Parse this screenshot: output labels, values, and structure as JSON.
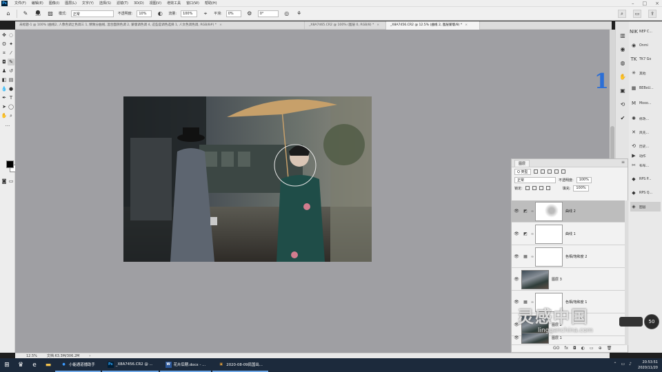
{
  "menu": {
    "items": [
      "文件(F)",
      "编辑(E)",
      "图像(I)",
      "图层(L)",
      "文字(Y)",
      "选择(S)",
      "滤镜(T)",
      "3D(D)",
      "视图(V)",
      "增效工具",
      "窗口(W)",
      "帮助(H)"
    ],
    "app_icon": "Ps"
  },
  "options": {
    "brush_size": "100",
    "mode_label": "模式:",
    "mode_value": "正常",
    "opacity_label": "不透明度:",
    "opacity_value": "10%",
    "flow_label": "流量:",
    "flow_value": "100%",
    "smooth_label": "平滑:",
    "smooth_value": "0%",
    "angle_value": "0°"
  },
  "tabs": [
    {
      "label": "未标题-1 @ 100% (曲线2, 人像色调之色调三 1, 精致分曲线, 混合面阴色调 2, 蒙版调色调 4, 这些是调色选择 1, 人文色调色调, RGB/8#) *",
      "close": "×"
    },
    {
      "label": "_X8A7465.CR2 @ 100% (图层 0, RGB/8) *",
      "close": "×"
    },
    {
      "label": "_X8A7456.CR2 @ 12.5% (曲线 2, 图层蒙版/8) *",
      "close": "×",
      "active": true
    }
  ],
  "brand_mark": "18",
  "status": {
    "zoom": "12.5%",
    "doc": "文档:63.3M/306.2M",
    "arrow": "›"
  },
  "right_panel_list": [
    {
      "icon": "NIK",
      "label": "NEP C..."
    },
    {
      "icon": "◉",
      "label": "Onmi"
    },
    {
      "icon": "TK",
      "label": "TK7 Go"
    },
    {
      "icon": "✳",
      "label": "其他"
    },
    {
      "icon": "▦",
      "label": "BEBoU..."
    },
    {
      "icon": "M",
      "label": "Mooo..."
    },
    {
      "icon": "✺",
      "label": "修改..."
    },
    {
      "icon": "✕",
      "label": "风先..."
    },
    {
      "icon": "⟲",
      "label": "历史..."
    },
    {
      "icon": "▶",
      "label": "动作"
    },
    {
      "icon": "✂",
      "label": "布布..."
    },
    {
      "icon": "◆",
      "label": "RPS P..."
    },
    {
      "icon": "◆",
      "label": "RPS Q..."
    },
    {
      "icon": "◈",
      "label": "图层"
    }
  ],
  "layers_panel": {
    "tab": "图层",
    "filter_label": "Q 类型",
    "blend_mode": "正常",
    "opacity_label": "不透明度:",
    "opacity_value": "100%",
    "lock_label": "锁定:",
    "fill_label": "填充:",
    "fill_value": "100%",
    "layers": [
      {
        "name": "曲线 2",
        "type": "adjust",
        "selected": true
      },
      {
        "name": "曲线 1",
        "type": "adjust"
      },
      {
        "name": "色相/饱和度 2",
        "type": "adjust"
      },
      {
        "name": "图层 3",
        "type": "image"
      },
      {
        "name": "色相/饱和度 1",
        "type": "adjust"
      },
      {
        "name": "图层 2",
        "type": "image"
      },
      {
        "name": "图层 1",
        "type": "image"
      }
    ],
    "footer_icons": [
      "GO",
      "fx",
      "◘",
      "◐",
      "▭",
      "⊕",
      "🗑"
    ]
  },
  "timer": "50",
  "watermark": {
    "cn": "灵感中国",
    "en": "lingganchina.com"
  },
  "taskbar": {
    "apps": [
      {
        "icon": "●",
        "label": "小能通道播助手"
      },
      {
        "icon": "Ps",
        "label": "_X8A7456.CR2 @ ..."
      },
      {
        "icon": "W",
        "label": "花卉后期.docx - ..."
      },
      {
        "icon": "▣",
        "label": "2020-08-09民国出..."
      }
    ],
    "time": "20:53:51",
    "date": "2020/11/20"
  }
}
